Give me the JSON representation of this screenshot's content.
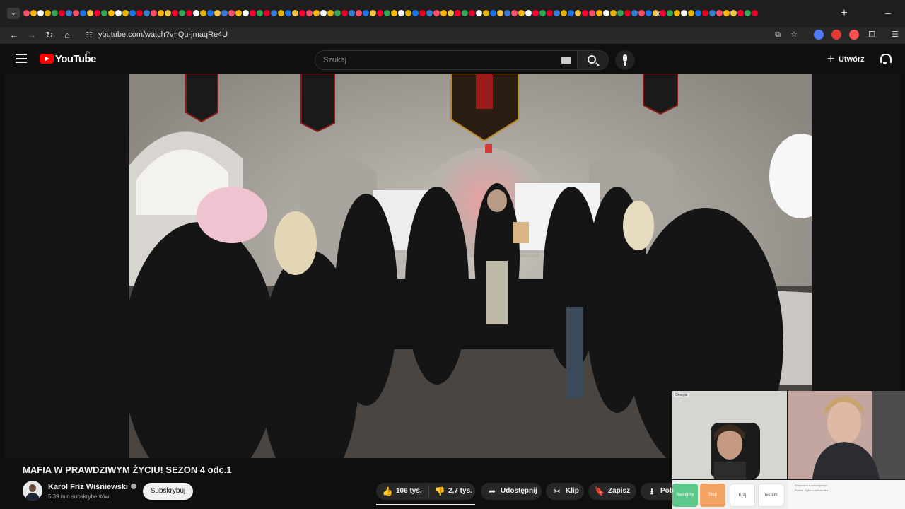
{
  "browser": {
    "url": "youtube.com/watch?v=Qu-jmaqRe4U",
    "tab_favicon_colors": [
      "#ff4d6d",
      "#e3b505",
      "#ff0033",
      "#3a7bd5",
      "#ffffff",
      "#f4c542",
      "#e60023",
      "#ffb703",
      "#1a73e8",
      "#34a853"
    ],
    "tab_close_label": "×",
    "new_tab_label": "+",
    "minimize_label": "–",
    "extension_colors": [
      "#4f7cff",
      "#e53935",
      "#ff5252",
      "#9e9e9e"
    ]
  },
  "youtube": {
    "logo_text": "YouTube",
    "region": "PL",
    "search_placeholder": "Szukaj",
    "create_label": "Utwórz"
  },
  "video": {
    "title": "MAFIA W PRAWDZIWYM ŻYCIU! SEZON 4 odc.1",
    "channel_name": "Karol Friz Wiśniewski",
    "subscribers": "5,39 mln subskrybentów",
    "subscribe_label": "Subskrybuj",
    "likes": "106 tys.",
    "dislikes": "2,7 tys.",
    "share_label": "Udostępnij",
    "clip_label": "Klip",
    "save_label": "Zapisz",
    "download_label": "Pob"
  },
  "facecam": {
    "overlay_label": "Omegle",
    "buttons": [
      {
        "label": "Następny",
        "color": "#5cc98a"
      },
      {
        "label": "Stop",
        "color": "#f4a261"
      },
      {
        "label": "Kraj",
        "color": "#ffffff"
      },
      {
        "label": "Jestem",
        "color": "#ffffff"
      }
    ],
    "chat_lines": [
      "Połączono z nieznajomym",
      "Polska. Zgłoś użytkownika"
    ]
  }
}
